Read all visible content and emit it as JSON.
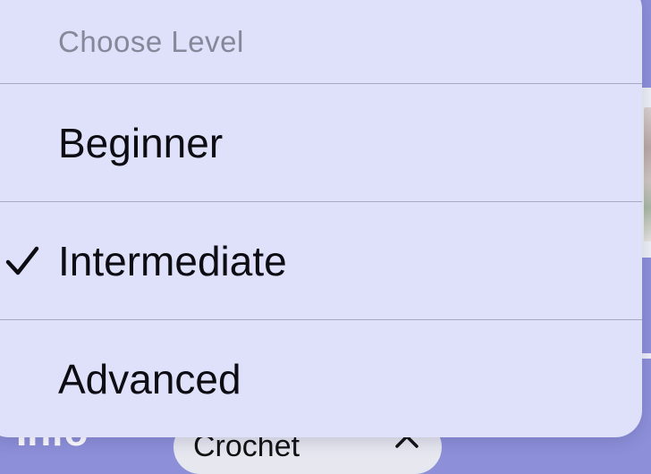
{
  "menu": {
    "header": "Choose Level",
    "items": [
      {
        "label": "Beginner",
        "selected": false
      },
      {
        "label": "Intermediate",
        "selected": true,
        "icon": "checkmark-icon"
      },
      {
        "label": "Advanced",
        "selected": false
      }
    ]
  },
  "background": {
    "info_text": "Info",
    "pill_label": "Crochet",
    "pill_icon": "chevron-up-icon"
  },
  "colors": {
    "menu_bg": "#dfe1fb",
    "page_bg": "#8d8fd9",
    "header_text": "#86889a",
    "item_text": "#0c0c12"
  }
}
